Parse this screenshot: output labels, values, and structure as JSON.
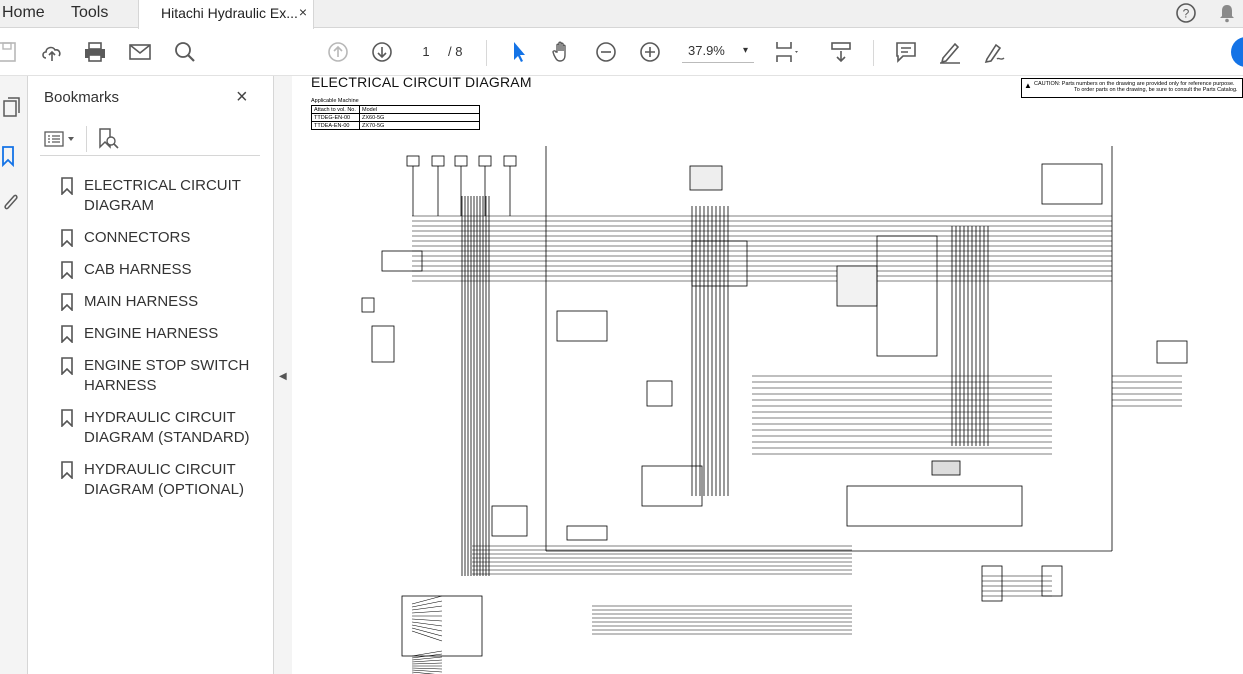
{
  "menu": {
    "home": "Home",
    "tools": "Tools"
  },
  "tab": {
    "title": "Hitachi Hydraulic Ex...",
    "close": "×"
  },
  "toolbar": {
    "page_current": "1",
    "page_total": "/ 8",
    "zoom": "37.9%",
    "zoom_caret": "▾"
  },
  "bookmarks": {
    "header": "Bookmarks",
    "close": "×",
    "items": [
      {
        "label": "ELECTRICAL CIRCUIT DIAGRAM"
      },
      {
        "label": "CONNECTORS"
      },
      {
        "label": "CAB HARNESS"
      },
      {
        "label": "MAIN HARNESS"
      },
      {
        "label": "ENGINE HARNESS"
      },
      {
        "label": "ENGINE STOP SWITCH HARNESS"
      },
      {
        "label": "HYDRAULIC CIRCUIT DIAGRAM (STANDARD)"
      },
      {
        "label": "HYDRAULIC CIRCUIT DIAGRAM (OPTIONAL)"
      }
    ]
  },
  "document": {
    "title": "ELECTRICAL CIRCUIT DIAGRAM",
    "caution_line1": "CAUTION: Parts numbers on the drawing are provided only for reference purpose.",
    "caution_line2": "To order parts on the drawing, be sure to consult the Parts Catalog.",
    "applicable_label": "Applicable Machine",
    "table_head": [
      "Attach to vol. No.",
      "Model"
    ],
    "table_rows": [
      [
        "TTDEG-EN-00",
        "ZX60-5G"
      ],
      [
        "TTDEA-EN-00",
        "ZX70-5G"
      ]
    ]
  },
  "colors": {
    "accent_blue": "#1473e6",
    "icon_gray": "#5a5a5a",
    "disabled_gray": "#b8b8b8"
  }
}
